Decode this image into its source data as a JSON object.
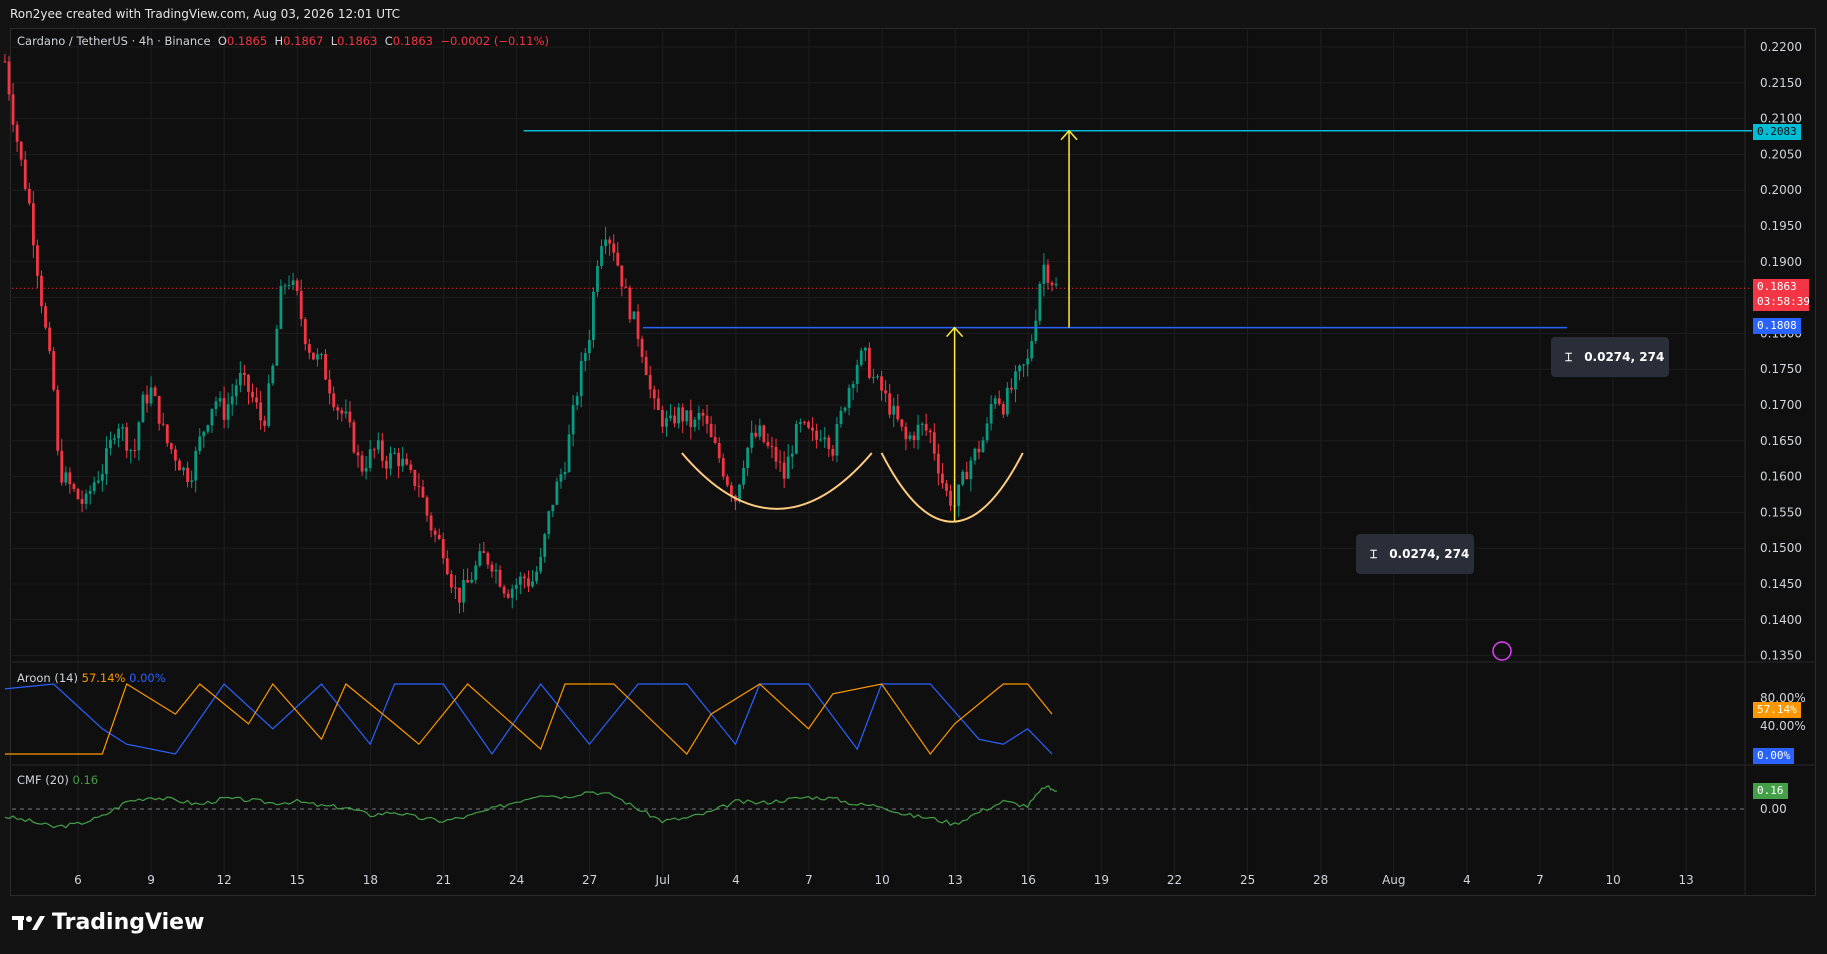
{
  "header": {
    "caption": "Ron2yee created with TradingView.com, Aug 03, 2026 12:01 UTC"
  },
  "legend": {
    "symbol": "Cardano / TetherUS · 4h · Binance",
    "o_label": "O",
    "o_value": "0.1865",
    "h_label": "H",
    "h_value": "0.1867",
    "l_label": "L",
    "l_value": "0.1863",
    "c_label": "C",
    "c_value": "0.1863",
    "change": "−0.0002 (−0.11%)"
  },
  "aroon_legend": {
    "name": "Aroon (14)",
    "up": "57.14%",
    "down": "0.00%"
  },
  "cmf_legend": {
    "name": "CMF (20)",
    "value": "0.16"
  },
  "price_labels": {
    "target": "0.2083",
    "last": "0.1863",
    "countdown": "03:58:39",
    "neckline": "0.1808"
  },
  "measures": {
    "depth": "0.0274, 274",
    "projection": "0.0274, 274"
  },
  "aroon_scale": [
    "80.00%",
    "40.00%"
  ],
  "aroon_badges": {
    "up": "57.14%",
    "down": "0.00%"
  },
  "cmf_scale": "0.00",
  "cmf_badge": "0.16",
  "brand": "TradingView",
  "colors": {
    "up": "#089981",
    "down": "#f23645",
    "aroon_up": "#ff9800",
    "aroon_down": "#2962ff",
    "cmf": "#43a047",
    "neckline": "#2962ff",
    "target_line": "#00bcd4",
    "arrow": "#ffeb3b",
    "arc": "#ffcc80",
    "bg": "#0f0f0f"
  },
  "chart_data": {
    "type": "candlestick",
    "title": "Cardano / TetherUS · 4h · Binance",
    "x_ticks": [
      "6",
      "9",
      "12",
      "15",
      "18",
      "21",
      "24",
      "27",
      "Jul",
      "4",
      "7",
      "10",
      "13",
      "16",
      "19",
      "22",
      "25",
      "28",
      "Aug",
      "4",
      "7",
      "10",
      "13"
    ],
    "y_ticks": [
      "0.2200",
      "0.2150",
      "0.2100",
      "0.2050",
      "0.2000",
      "0.1950",
      "0.1900",
      "0.1850",
      "0.1800",
      "0.1750",
      "0.1700",
      "0.1650",
      "0.1600",
      "0.1550",
      "0.1500",
      "0.1450",
      "0.1400",
      "0.1350"
    ],
    "ylim": [
      0.1335,
      0.2225
    ],
    "day_range": [
      3,
      45
    ],
    "price_path": [
      [
        3.0,
        0.218
      ],
      [
        3.3,
        0.211
      ],
      [
        3.6,
        0.205
      ],
      [
        4.0,
        0.198
      ],
      [
        4.3,
        0.19
      ],
      [
        4.6,
        0.182
      ],
      [
        5.0,
        0.172
      ],
      [
        5.2,
        0.161
      ],
      [
        5.6,
        0.159
      ],
      [
        6.0,
        0.157
      ],
      [
        6.3,
        0.156
      ],
      [
        6.6,
        0.159
      ],
      [
        7.0,
        0.161
      ],
      [
        7.3,
        0.164
      ],
      [
        7.6,
        0.168
      ],
      [
        8.0,
        0.165
      ],
      [
        8.3,
        0.163
      ],
      [
        8.6,
        0.17
      ],
      [
        9.0,
        0.172
      ],
      [
        9.3,
        0.169
      ],
      [
        9.6,
        0.165
      ],
      [
        10.0,
        0.163
      ],
      [
        10.3,
        0.161
      ],
      [
        10.6,
        0.16
      ],
      [
        11.0,
        0.165
      ],
      [
        11.3,
        0.168
      ],
      [
        11.6,
        0.171
      ],
      [
        12.0,
        0.169
      ],
      [
        12.3,
        0.171
      ],
      [
        12.6,
        0.174
      ],
      [
        13.0,
        0.172
      ],
      [
        13.3,
        0.17
      ],
      [
        13.6,
        0.167
      ],
      [
        14.0,
        0.175
      ],
      [
        14.3,
        0.185
      ],
      [
        14.6,
        0.188
      ],
      [
        15.0,
        0.185
      ],
      [
        15.3,
        0.18
      ],
      [
        15.6,
        0.177
      ],
      [
        16.0,
        0.176
      ],
      [
        16.3,
        0.173
      ],
      [
        16.6,
        0.17
      ],
      [
        17.0,
        0.168
      ],
      [
        17.3,
        0.165
      ],
      [
        17.6,
        0.161
      ],
      [
        18.0,
        0.163
      ],
      [
        18.3,
        0.164
      ],
      [
        18.6,
        0.162
      ],
      [
        19.0,
        0.163
      ],
      [
        19.3,
        0.162
      ],
      [
        19.6,
        0.16
      ],
      [
        20.0,
        0.159
      ],
      [
        20.3,
        0.155
      ],
      [
        20.6,
        0.152
      ],
      [
        21.0,
        0.15
      ],
      [
        21.3,
        0.146
      ],
      [
        21.6,
        0.143
      ],
      [
        22.0,
        0.145
      ],
      [
        22.3,
        0.147
      ],
      [
        22.6,
        0.149
      ],
      [
        23.0,
        0.148
      ],
      [
        23.3,
        0.146
      ],
      [
        23.6,
        0.144
      ],
      [
        24.0,
        0.145
      ],
      [
        24.3,
        0.146
      ],
      [
        24.6,
        0.145
      ],
      [
        25.0,
        0.148
      ],
      [
        25.3,
        0.154
      ],
      [
        25.6,
        0.158
      ],
      [
        26.0,
        0.162
      ],
      [
        26.3,
        0.168
      ],
      [
        26.6,
        0.174
      ],
      [
        27.0,
        0.18
      ],
      [
        27.3,
        0.19
      ],
      [
        27.6,
        0.195
      ],
      [
        28.0,
        0.192
      ],
      [
        28.3,
        0.188
      ],
      [
        28.6,
        0.184
      ],
      [
        29.0,
        0.18
      ],
      [
        29.3,
        0.176
      ],
      [
        29.6,
        0.17
      ],
      [
        30.0,
        0.168
      ],
      [
        30.3,
        0.167
      ],
      [
        30.6,
        0.169
      ],
      [
        31.0,
        0.168
      ],
      [
        31.3,
        0.167
      ],
      [
        31.6,
        0.169
      ],
      [
        32.0,
        0.165
      ],
      [
        32.3,
        0.163
      ],
      [
        32.6,
        0.16
      ],
      [
        33.0,
        0.157
      ],
      [
        33.3,
        0.162
      ],
      [
        33.6,
        0.165
      ],
      [
        34.0,
        0.166
      ],
      [
        34.3,
        0.164
      ],
      [
        34.6,
        0.163
      ],
      [
        35.0,
        0.16
      ],
      [
        35.3,
        0.164
      ],
      [
        35.6,
        0.167
      ],
      [
        36.0,
        0.166
      ],
      [
        36.3,
        0.165
      ],
      [
        36.6,
        0.167
      ],
      [
        37.0,
        0.164
      ],
      [
        37.3,
        0.168
      ],
      [
        37.6,
        0.172
      ],
      [
        38.0,
        0.176
      ],
      [
        38.3,
        0.177
      ],
      [
        38.6,
        0.174
      ],
      [
        39.0,
        0.172
      ],
      [
        39.3,
        0.17
      ],
      [
        39.6,
        0.168
      ],
      [
        40.0,
        0.165
      ],
      [
        40.3,
        0.166
      ],
      [
        40.6,
        0.167
      ],
      [
        41.0,
        0.166
      ],
      [
        41.3,
        0.162
      ],
      [
        41.6,
        0.158
      ],
      [
        42.0,
        0.156
      ],
      [
        42.3,
        0.159
      ],
      [
        42.6,
        0.162
      ],
      [
        43.0,
        0.164
      ],
      [
        43.3,
        0.166
      ],
      [
        43.6,
        0.172
      ],
      [
        44.0,
        0.17
      ],
      [
        44.3,
        0.172
      ],
      [
        44.6,
        0.174
      ],
      [
        45.0,
        0.176
      ],
      [
        45.3,
        0.182
      ],
      [
        45.6,
        0.19
      ],
      [
        45.9,
        0.188
      ],
      [
        46.2,
        0.1863
      ]
    ],
    "aroon_up_path": [
      [
        3,
        0
      ],
      [
        7,
        0
      ],
      [
        8,
        100
      ],
      [
        10,
        57
      ],
      [
        11,
        100
      ],
      [
        13,
        43
      ],
      [
        14,
        100
      ],
      [
        16,
        21
      ],
      [
        17,
        100
      ],
      [
        19,
        43
      ],
      [
        20,
        14
      ],
      [
        22,
        100
      ],
      [
        25,
        7
      ],
      [
        26,
        100
      ],
      [
        28,
        100
      ],
      [
        31,
        0
      ],
      [
        32,
        57
      ],
      [
        34,
        100
      ],
      [
        36,
        36
      ],
      [
        37,
        86
      ],
      [
        39,
        100
      ],
      [
        41,
        0
      ],
      [
        42,
        43
      ],
      [
        44,
        100
      ],
      [
        45,
        100
      ],
      [
        46,
        57
      ]
    ],
    "aroon_down_path": [
      [
        3,
        93
      ],
      [
        5,
        100
      ],
      [
        7,
        36
      ],
      [
        8,
        14
      ],
      [
        10,
        0
      ],
      [
        12,
        100
      ],
      [
        14,
        36
      ],
      [
        16,
        100
      ],
      [
        18,
        14
      ],
      [
        19,
        100
      ],
      [
        21,
        100
      ],
      [
        23,
        0
      ],
      [
        25,
        100
      ],
      [
        27,
        14
      ],
      [
        29,
        100
      ],
      [
        31,
        100
      ],
      [
        33,
        14
      ],
      [
        34,
        100
      ],
      [
        36,
        100
      ],
      [
        38,
        7
      ],
      [
        39,
        100
      ],
      [
        41,
        100
      ],
      [
        43,
        21
      ],
      [
        44,
        14
      ],
      [
        45,
        36
      ],
      [
        46,
        0
      ]
    ],
    "aroon_ylim": [
      0,
      100
    ],
    "cmf_path": [
      [
        3,
        -0.05
      ],
      [
        4,
        -0.08
      ],
      [
        5,
        -0.12
      ],
      [
        6,
        -0.1
      ],
      [
        7,
        -0.05
      ],
      [
        8,
        0.05
      ],
      [
        9,
        0.08
      ],
      [
        10,
        0.06
      ],
      [
        11,
        0.03
      ],
      [
        12,
        0.07
      ],
      [
        13,
        0.06
      ],
      [
        14,
        0.04
      ],
      [
        15,
        0.05
      ],
      [
        16,
        0.02
      ],
      [
        17,
        0.01
      ],
      [
        18,
        -0.04
      ],
      [
        19,
        -0.02
      ],
      [
        20,
        -0.06
      ],
      [
        21,
        -0.08
      ],
      [
        22,
        -0.05
      ],
      [
        23,
        0.0
      ],
      [
        24,
        0.05
      ],
      [
        25,
        0.1
      ],
      [
        26,
        0.08
      ],
      [
        27,
        0.12
      ],
      [
        28,
        0.09
      ],
      [
        29,
        0.0
      ],
      [
        30,
        -0.08
      ],
      [
        31,
        -0.06
      ],
      [
        32,
        -0.02
      ],
      [
        33,
        0.05
      ],
      [
        34,
        0.04
      ],
      [
        35,
        0.06
      ],
      [
        36,
        0.08
      ],
      [
        37,
        0.07
      ],
      [
        38,
        0.03
      ],
      [
        39,
        0.02
      ],
      [
        40,
        -0.04
      ],
      [
        41,
        -0.06
      ],
      [
        42,
        -0.1
      ],
      [
        43,
        -0.02
      ],
      [
        44,
        0.05
      ],
      [
        45,
        0.02
      ],
      [
        45.7,
        0.15
      ],
      [
        46.2,
        0.12
      ]
    ],
    "cmf_ylim": [
      -0.2,
      0.2
    ],
    "levels": {
      "neckline": 0.1808,
      "target": 0.2083
    },
    "arcs": [
      {
        "from_day": 30.8,
        "to_day": 38.6,
        "low": 0.1555,
        "top": 0.1633
      },
      {
        "from_day": 39.0,
        "to_day": 44.8,
        "low": 0.1537,
        "top": 0.1633
      }
    ],
    "arrows": [
      {
        "day": 42.0,
        "from": 0.1537,
        "to": 0.1808
      },
      {
        "day": 46.7,
        "from": 0.1808,
        "to": 0.2083
      }
    ]
  }
}
